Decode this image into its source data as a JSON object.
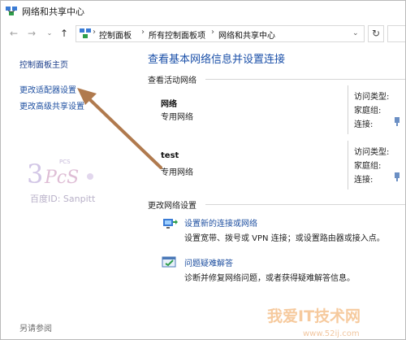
{
  "window": {
    "title": "网络和共享中心"
  },
  "nav": {
    "back_glyph": "←",
    "forward_glyph": "→",
    "up_glyph": "↑",
    "refresh_glyph": "↻",
    "dropdown_glyph": "⌄",
    "breadcrumbs": [
      "控制面板",
      "所有控制面板项",
      "网络和共享中心"
    ],
    "sep": "›"
  },
  "sidebar": {
    "home_link": "控制面板主页",
    "links": [
      "更改适配器设置",
      "更改高级共享设置"
    ],
    "see_also": "另请参阅"
  },
  "main": {
    "title": "查看基本网络信息并设置连接",
    "active_networks_header": "查看活动网络",
    "networks": [
      {
        "name": "网络",
        "type": "专用网络",
        "props": [
          "访问类型:",
          "家庭组:",
          "连接:"
        ]
      },
      {
        "name": "test",
        "type": "专用网络",
        "props": [
          "访问类型:",
          "家庭组:",
          "连接:"
        ]
      }
    ],
    "change_settings_header": "更改网络设置",
    "tasks": [
      {
        "link": "设置新的连接或网络",
        "desc": "设置宽带、拨号或 VPN 连接；或设置路由器或接入点。"
      },
      {
        "link": "问题疑难解答",
        "desc": "诊断并修复网络问题，或者获得疑难解答信息。"
      }
    ]
  },
  "watermark": {
    "baidu_id": "百度ID: Sanpitt",
    "site_name": "我爱IT技术网",
    "site_url": "www.52ij.com"
  },
  "colors": {
    "link": "#1e4fa0",
    "title": "#1a4fa8",
    "arrow": "#b07a4e"
  }
}
